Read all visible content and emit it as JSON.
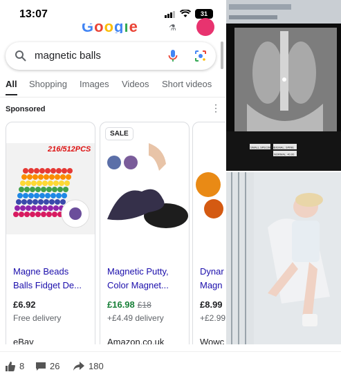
{
  "status_bar": {
    "time": "13:07",
    "battery": "31"
  },
  "search": {
    "query": "magnetic balls"
  },
  "tabs": [
    {
      "label": "All",
      "active": true
    },
    {
      "label": "Shopping"
    },
    {
      "label": "Images"
    },
    {
      "label": "Videos"
    },
    {
      "label": "Short videos"
    }
  ],
  "sponsored_label": "Sponsored",
  "products": [
    {
      "title_line1": "Magne Beads",
      "title_line2": "Balls Fidget De...",
      "price": "£6.92",
      "was": "",
      "delivery": "Free delivery",
      "store": "eBay",
      "badge": "",
      "image_caption": "216/512PCS"
    },
    {
      "title_line1": "Magnetic Putty,",
      "title_line2": "Color Magnet...",
      "price": "£16.98",
      "was": "£18",
      "delivery": "+£4.49 delivery",
      "store": "Amazon.co.uk",
      "badge": "SALE"
    },
    {
      "title_line1": "Dynar",
      "title_line2": "Magn",
      "price": "£8.99",
      "was": "",
      "delivery": "+£2.99",
      "store": "Wowc",
      "badge": ""
    }
  ],
  "xray_labels": [
    "SMALL SPECIMEN",
    "SIGNAL: SPINE",
    "NORMAL: 40.00"
  ],
  "footer": {
    "likes": "8",
    "comments": "26",
    "shares": "180"
  },
  "colors": {
    "link": "#1a0dab",
    "sale_price": "#188038",
    "google_pink": "#e8336f"
  }
}
